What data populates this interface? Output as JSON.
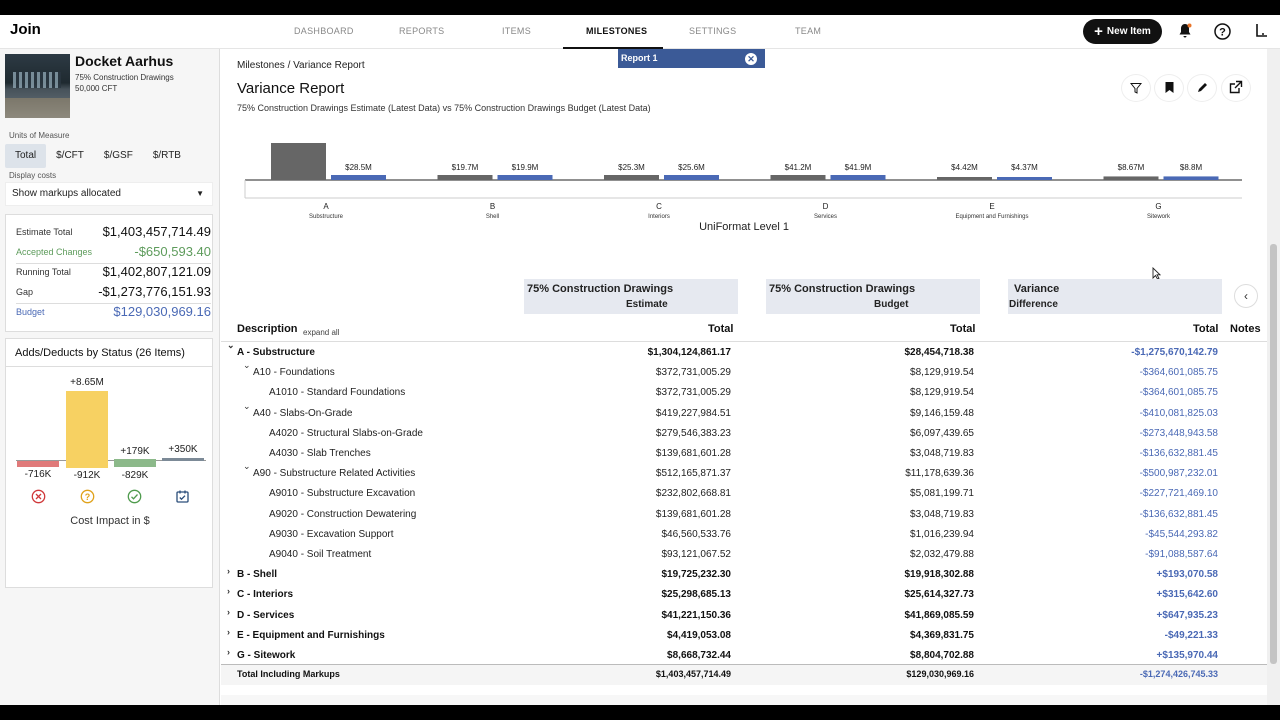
{
  "app": {
    "logo": "Join"
  },
  "nav": {
    "items": [
      "DASHBOARD",
      "REPORTS",
      "ITEMS",
      "MILESTONES",
      "SETTINGS",
      "TEAM"
    ],
    "active": "MILESTONES",
    "new_item": "New Item"
  },
  "project": {
    "name": "Docket Aarhus",
    "milestone": "75% Construction Drawings",
    "area": "50,000 CFT"
  },
  "units": {
    "label": "Units of Measure",
    "options": [
      "Total",
      "$/CFT",
      "$/GSF",
      "$/RTB"
    ],
    "selected": "Total"
  },
  "display_costs": {
    "label": "Display costs",
    "value": "Show markups allocated"
  },
  "totals": [
    {
      "label": "Estimate Total",
      "value": "$1,403,457,714.49",
      "style": "normal"
    },
    {
      "label": "Accepted Changes",
      "value": "-$650,593.40",
      "style": "green"
    },
    {
      "label": "Running Total",
      "value": "$1,402,807,121.09",
      "style": "normal"
    },
    {
      "label": "Gap",
      "value": "-$1,273,776,151.93",
      "style": "normal"
    },
    {
      "label": "Budget",
      "value": "$129,030,969.16",
      "style": "blue"
    }
  ],
  "adds": {
    "title": "Adds/Deducts by Status (26 Items)",
    "statuses": [
      {
        "status": "Rejected",
        "add": "",
        "deduct": "-716K",
        "color": "#e07a7a",
        "icon": "rejected-icon"
      },
      {
        "status": "Pending",
        "add": "+8.65M",
        "deduct": "-912K",
        "color": "#f7d162",
        "icon": "pending-icon"
      },
      {
        "status": "Accepted",
        "add": "+179K",
        "deduct": "-829K",
        "color": "#8cb98a",
        "icon": "accepted-icon"
      },
      {
        "status": "Incorporated",
        "add": "+350K",
        "deduct": "",
        "color": "#7c8a97",
        "icon": "incorporated-icon"
      }
    ],
    "footer": "Cost Impact in $"
  },
  "report": {
    "breadcrumb": "Milestones / Variance Report",
    "title": "Variance Report",
    "subtitle": "75% Construction Drawings Estimate (Latest Data) vs 75% Construction Drawings Budget (Latest Data)",
    "chip": "Report 1"
  },
  "chart_data": {
    "type": "bar",
    "xlabel": "UniFormat Level 1",
    "categories": [
      "A",
      "B",
      "C",
      "D",
      "E",
      "G"
    ],
    "category_names": [
      "Substructure",
      "Shell",
      "Interiors",
      "Services",
      "Equipment and Furnishings",
      "Sitework"
    ],
    "series": [
      {
        "name": "Estimate",
        "color": "#666666",
        "values": [
          1304.1,
          19.7,
          25.3,
          41.2,
          4.42,
          8.67
        ],
        "labels": [
          "",
          "$19.7M",
          "$25.3M",
          "$41.2M",
          "$4.42M",
          "$8.67M"
        ]
      },
      {
        "name": "Budget",
        "color": "#4a69b5",
        "values": [
          28.5,
          19.9,
          25.6,
          41.9,
          4.37,
          8.8
        ],
        "labels": [
          "$28.5M",
          "$19.9M",
          "$25.6M",
          "$41.9M",
          "$4.37M",
          "$8.8M"
        ]
      }
    ]
  },
  "table": {
    "col_estimate": {
      "title": "75% Construction Drawings",
      "sub": "Estimate"
    },
    "col_budget": {
      "title": "75% Construction Drawings",
      "sub": "Budget"
    },
    "col_variance": {
      "title": "Variance",
      "sub": "Difference"
    },
    "description": "Description",
    "expand_all": "expand all",
    "total": "Total",
    "notes": "Notes",
    "rows": [
      {
        "desc": "A - Substructure",
        "toggle": "⌄",
        "level": 0,
        "bold": true,
        "est": "$1,304,124,861.17",
        "bud": "$28,454,718.38",
        "var": "-$1,275,670,142.79"
      },
      {
        "desc": "A10 - Foundations",
        "toggle": "⌄",
        "level": 1,
        "bold": false,
        "est": "$372,731,005.29",
        "bud": "$8,129,919.54",
        "var": "-$364,601,085.75"
      },
      {
        "desc": "A1010 - Standard Foundations",
        "toggle": "",
        "level": 2,
        "bold": false,
        "est": "$372,731,005.29",
        "bud": "$8,129,919.54",
        "var": "-$364,601,085.75"
      },
      {
        "desc": "A40 - Slabs-On-Grade",
        "toggle": "⌄",
        "level": 1,
        "bold": false,
        "est": "$419,227,984.51",
        "bud": "$9,146,159.48",
        "var": "-$410,081,825.03"
      },
      {
        "desc": "A4020 - Structural Slabs-on-Grade",
        "toggle": "",
        "level": 2,
        "bold": false,
        "est": "$279,546,383.23",
        "bud": "$6,097,439.65",
        "var": "-$273,448,943.58"
      },
      {
        "desc": "A4030 - Slab Trenches",
        "toggle": "",
        "level": 2,
        "bold": false,
        "est": "$139,681,601.28",
        "bud": "$3,048,719.83",
        "var": "-$136,632,881.45"
      },
      {
        "desc": "A90 - Substructure Related Activities",
        "toggle": "⌄",
        "level": 1,
        "bold": false,
        "est": "$512,165,871.37",
        "bud": "$11,178,639.36",
        "var": "-$500,987,232.01"
      },
      {
        "desc": "A9010 - Substructure Excavation",
        "toggle": "",
        "level": 2,
        "bold": false,
        "est": "$232,802,668.81",
        "bud": "$5,081,199.71",
        "var": "-$227,721,469.10"
      },
      {
        "desc": "A9020 - Construction Dewatering",
        "toggle": "",
        "level": 2,
        "bold": false,
        "est": "$139,681,601.28",
        "bud": "$3,048,719.83",
        "var": "-$136,632,881.45"
      },
      {
        "desc": "A9030 - Excavation Support",
        "toggle": "",
        "level": 2,
        "bold": false,
        "est": "$46,560,533.76",
        "bud": "$1,016,239.94",
        "var": "-$45,544,293.82"
      },
      {
        "desc": "A9040 - Soil Treatment",
        "toggle": "",
        "level": 2,
        "bold": false,
        "est": "$93,121,067.52",
        "bud": "$2,032,479.88",
        "var": "-$91,088,587.64"
      },
      {
        "desc": "B - Shell",
        "toggle": "›",
        "level": 0,
        "bold": true,
        "est": "$19,725,232.30",
        "bud": "$19,918,302.88",
        "var": "+$193,070.58"
      },
      {
        "desc": "C - Interiors",
        "toggle": "›",
        "level": 0,
        "bold": true,
        "est": "$25,298,685.13",
        "bud": "$25,614,327.73",
        "var": "+$315,642.60"
      },
      {
        "desc": "D - Services",
        "toggle": "›",
        "level": 0,
        "bold": true,
        "est": "$41,221,150.36",
        "bud": "$41,869,085.59",
        "var": "+$647,935.23"
      },
      {
        "desc": "E - Equipment and Furnishings",
        "toggle": "›",
        "level": 0,
        "bold": true,
        "est": "$4,419,053.08",
        "bud": "$4,369,831.75",
        "var": "-$49,221.33"
      },
      {
        "desc": "G - Sitework",
        "toggle": "›",
        "level": 0,
        "bold": true,
        "est": "$8,668,732.44",
        "bud": "$8,804,702.88",
        "var": "+$135,970.44"
      }
    ],
    "total_row": {
      "desc": "Total Including Markups",
      "est": "$1,403,457,714.49",
      "bud": "$129,030,969.16",
      "var": "-$1,274,426,745.33"
    }
  }
}
